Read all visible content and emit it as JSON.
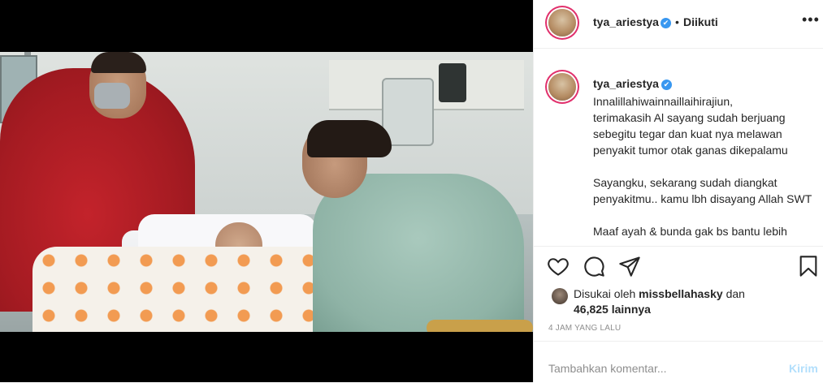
{
  "header": {
    "username": "tya_ariestya",
    "verified_mark": "✔",
    "separator": "•",
    "follow_status": "Diikuti",
    "more_label": "•••"
  },
  "caption": {
    "username": "tya_ariestya",
    "verified_mark": "✔",
    "text": "Innalillahiwainnaillaihirajiun,\nterimakasih Al sayang sudah berjuang sebegitu tegar dan kuat nya melawan penyakit tumor otak ganas dikepalamu\n\nSayangku, sekarang sudah diangkat penyakitmu.. kamu lbh disayang Allah SWT\n\nMaaf ayah & bunda gak bs bantu lebih"
  },
  "actions": {
    "icons": [
      "heart-icon",
      "comment-icon",
      "share-icon",
      "bookmark-icon"
    ]
  },
  "likes": {
    "prefix": "Disukai oleh",
    "user": "missbellahasky",
    "conj": "dan",
    "others": "46,825 lainnya"
  },
  "timestamp": "4 JAM YANG LALU",
  "comment": {
    "placeholder": "Tambahkan komentar...",
    "post_label": "Kirim"
  },
  "colors": {
    "verified": "#3897f0",
    "post_disabled": "#b2dffc",
    "ring": "#e1306c"
  }
}
